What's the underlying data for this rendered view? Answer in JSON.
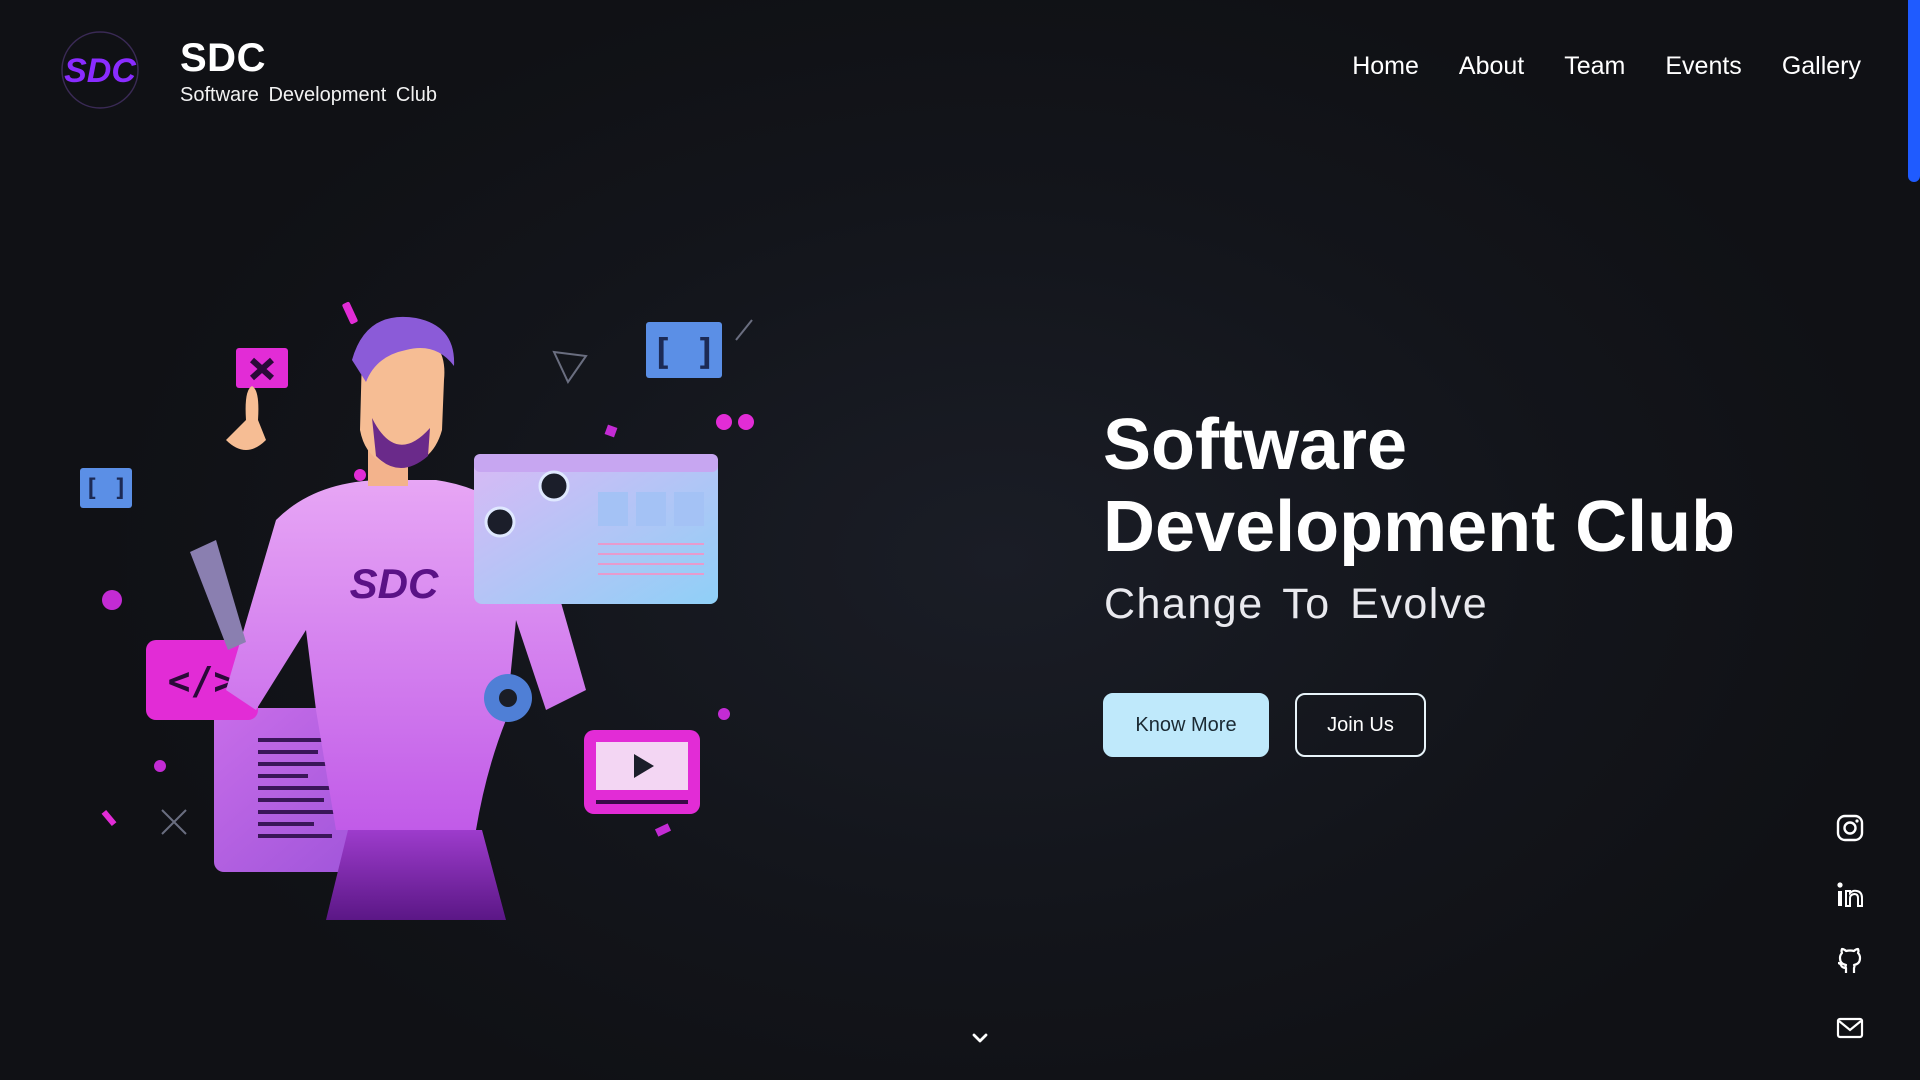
{
  "brand": {
    "logo_text": "SDC",
    "title": "SDC",
    "subtitle": "Software Development Club"
  },
  "nav": {
    "items": [
      "Home",
      "About",
      "Team",
      "Events",
      "Gallery"
    ]
  },
  "hero": {
    "title_line1": "Software",
    "title_line2": "Development Club",
    "tagline": "Change To Evolve",
    "primary_button": "Know More",
    "secondary_button": "Join Us"
  },
  "illustration": {
    "shirt_text": "SDC",
    "code_tag": "</>",
    "bracket_tag": "[ ]"
  },
  "social": [
    "instagram-icon",
    "linkedin-icon",
    "github-icon",
    "mail-icon"
  ],
  "colors": {
    "accent": "#bfe9fb",
    "purple": "#a23bff",
    "magenta": "#e22cd6",
    "scroll": "#1f5bff"
  }
}
